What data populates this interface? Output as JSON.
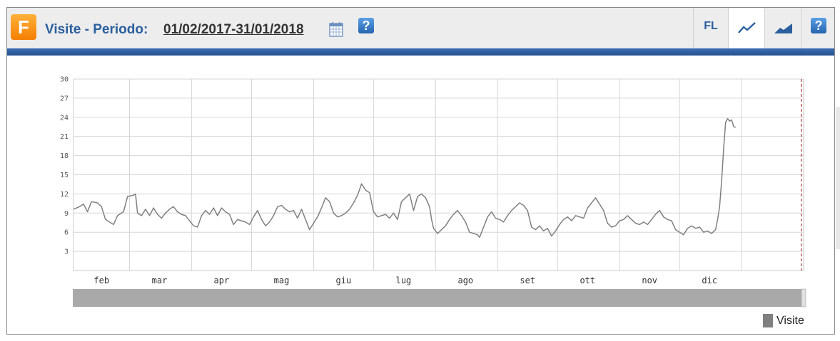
{
  "header": {
    "app_icon_letter": "F",
    "title": "Visite - Periodo:",
    "period": "01/02/2017-31/01/2018",
    "help_glyph": "?",
    "toolbar_fl": "FL"
  },
  "icons": [
    "calendar-icon",
    "help-icon",
    "line-chart-icon",
    "area-chart-icon"
  ],
  "colors": {
    "accent": "#2b5f9e",
    "brand": "#f58a00",
    "series": "#808080"
  },
  "chart_data": {
    "type": "line",
    "y_ticks": [
      3,
      6,
      9,
      12,
      15,
      18,
      21,
      24,
      27,
      30
    ],
    "ylim": [
      0,
      30
    ],
    "xlim": [
      0,
      365
    ],
    "x_ticks": [
      {
        "label": "feb",
        "mid": 14,
        "boundary": 28
      },
      {
        "label": "mar",
        "mid": 43,
        "boundary": 59
      },
      {
        "label": "apr",
        "mid": 74,
        "boundary": 89
      },
      {
        "label": "mag",
        "mid": 104,
        "boundary": 120
      },
      {
        "label": "giu",
        "mid": 135,
        "boundary": 150
      },
      {
        "label": "lug",
        "mid": 165,
        "boundary": 181
      },
      {
        "label": "ago",
        "mid": 196,
        "boundary": 212
      },
      {
        "label": "set",
        "mid": 227,
        "boundary": 242
      },
      {
        "label": "ott",
        "mid": 257,
        "boundary": 273
      },
      {
        "label": "nov",
        "mid": 288,
        "boundary": 303
      },
      {
        "label": "dic",
        "mid": 318,
        "boundary": 334
      }
    ],
    "grid": true,
    "legend_position": "bottom-right",
    "series": [
      {
        "name": "Visite",
        "points": [
          [
            0,
            9.6
          ],
          [
            3,
            10
          ],
          [
            5,
            10.4
          ],
          [
            7,
            9.2
          ],
          [
            9,
            10.8
          ],
          [
            12,
            10.6
          ],
          [
            14,
            10
          ],
          [
            16,
            8
          ],
          [
            18,
            7.6
          ],
          [
            20,
            7.2
          ],
          [
            22,
            8.6
          ],
          [
            25,
            9.2
          ],
          [
            27,
            11.6
          ],
          [
            30,
            11.8
          ],
          [
            31,
            12
          ],
          [
            32,
            9
          ],
          [
            34,
            8.6
          ],
          [
            36,
            9.6
          ],
          [
            38,
            8.6
          ],
          [
            40,
            9.8
          ],
          [
            42,
            8.8
          ],
          [
            44,
            8.2
          ],
          [
            46,
            9
          ],
          [
            48,
            9.6
          ],
          [
            50,
            10
          ],
          [
            52,
            9.2
          ],
          [
            54,
            8.8
          ],
          [
            56,
            8.6
          ],
          [
            58,
            7.8
          ],
          [
            60,
            7
          ],
          [
            62,
            6.8
          ],
          [
            64,
            8.6
          ],
          [
            66,
            9.4
          ],
          [
            68,
            8.8
          ],
          [
            70,
            9.8
          ],
          [
            72,
            8.6
          ],
          [
            74,
            9.8
          ],
          [
            76,
            9.2
          ],
          [
            78,
            8.8
          ],
          [
            80,
            7.2
          ],
          [
            82,
            8
          ],
          [
            84,
            7.8
          ],
          [
            86,
            7.6
          ],
          [
            88,
            7.2
          ],
          [
            90,
            8.4
          ],
          [
            92,
            9.4
          ],
          [
            94,
            8
          ],
          [
            96,
            7
          ],
          [
            98,
            7.6
          ],
          [
            100,
            8.6
          ],
          [
            102,
            10
          ],
          [
            104,
            10.2
          ],
          [
            106,
            9.6
          ],
          [
            108,
            9.2
          ],
          [
            110,
            9.4
          ],
          [
            112,
            8.2
          ],
          [
            114,
            9.6
          ],
          [
            116,
            8
          ],
          [
            118,
            6.4
          ],
          [
            120,
            7.4
          ],
          [
            122,
            8.4
          ],
          [
            124,
            9.8
          ],
          [
            126,
            11.4
          ],
          [
            128,
            10.8
          ],
          [
            130,
            9
          ],
          [
            132,
            8.4
          ],
          [
            134,
            8.6
          ],
          [
            136,
            9
          ],
          [
            138,
            9.6
          ],
          [
            140,
            10.6
          ],
          [
            142,
            11.8
          ],
          [
            144,
            13.6
          ],
          [
            146,
            12.6
          ],
          [
            148,
            12.2
          ],
          [
            150,
            9.2
          ],
          [
            152,
            8.4
          ],
          [
            154,
            8.6
          ],
          [
            156,
            8.8
          ],
          [
            158,
            8.2
          ],
          [
            160,
            9
          ],
          [
            162,
            8
          ],
          [
            164,
            10.8
          ],
          [
            166,
            11.4
          ],
          [
            168,
            12
          ],
          [
            170,
            9.4
          ],
          [
            172,
            11.6
          ],
          [
            174,
            12
          ],
          [
            176,
            11.4
          ],
          [
            178,
            10
          ],
          [
            179,
            8
          ],
          [
            180,
            6.6
          ],
          [
            182,
            5.8
          ],
          [
            184,
            6.4
          ],
          [
            186,
            7
          ],
          [
            188,
            8
          ],
          [
            190,
            8.8
          ],
          [
            192,
            9.4
          ],
          [
            194,
            8.6
          ],
          [
            196,
            7.6
          ],
          [
            198,
            6
          ],
          [
            200,
            5.8
          ],
          [
            202,
            5.6
          ],
          [
            203,
            5.2
          ],
          [
            205,
            6.8
          ],
          [
            207,
            8.4
          ],
          [
            209,
            9.2
          ],
          [
            211,
            8.2
          ],
          [
            213,
            8
          ],
          [
            215,
            7.6
          ],
          [
            217,
            8.6
          ],
          [
            219,
            9.4
          ],
          [
            221,
            10
          ],
          [
            223,
            10.6
          ],
          [
            225,
            10.2
          ],
          [
            227,
            9.4
          ],
          [
            229,
            6.8
          ],
          [
            231,
            6.4
          ],
          [
            233,
            7
          ],
          [
            235,
            6.2
          ],
          [
            237,
            6.6
          ],
          [
            239,
            5.4
          ],
          [
            241,
            6.2
          ],
          [
            243,
            7.2
          ],
          [
            245,
            8
          ],
          [
            247,
            8.4
          ],
          [
            249,
            7.8
          ],
          [
            251,
            8.6
          ],
          [
            253,
            8.4
          ],
          [
            255,
            8.2
          ],
          [
            257,
            9.8
          ],
          [
            259,
            10.6
          ],
          [
            261,
            11.4
          ],
          [
            263,
            10.4
          ],
          [
            265,
            9.4
          ],
          [
            267,
            7.4
          ],
          [
            269,
            6.8
          ],
          [
            271,
            7
          ],
          [
            273,
            7.8
          ],
          [
            275,
            8
          ],
          [
            277,
            8.6
          ],
          [
            279,
            8
          ],
          [
            281,
            7.4
          ],
          [
            283,
            7.2
          ],
          [
            285,
            7.6
          ],
          [
            287,
            7.2
          ],
          [
            289,
            8
          ],
          [
            291,
            8.8
          ],
          [
            293,
            9.4
          ],
          [
            295,
            8.4
          ],
          [
            297,
            8
          ],
          [
            299,
            7.8
          ],
          [
            301,
            6.4
          ],
          [
            303,
            6
          ],
          [
            305,
            5.6
          ],
          [
            307,
            6.6
          ],
          [
            309,
            7
          ],
          [
            311,
            6.6
          ],
          [
            313,
            6.8
          ],
          [
            315,
            6
          ],
          [
            317,
            6.2
          ],
          [
            319,
            5.8
          ],
          [
            321,
            6.4
          ],
          [
            322,
            8
          ],
          [
            323,
            10
          ],
          [
            324,
            14
          ],
          [
            325,
            19
          ],
          [
            326,
            23.2
          ],
          [
            327,
            23.8
          ],
          [
            328,
            23.4
          ],
          [
            329,
            23.6
          ],
          [
            330,
            22.6
          ],
          [
            331,
            22.4
          ]
        ]
      }
    ]
  }
}
